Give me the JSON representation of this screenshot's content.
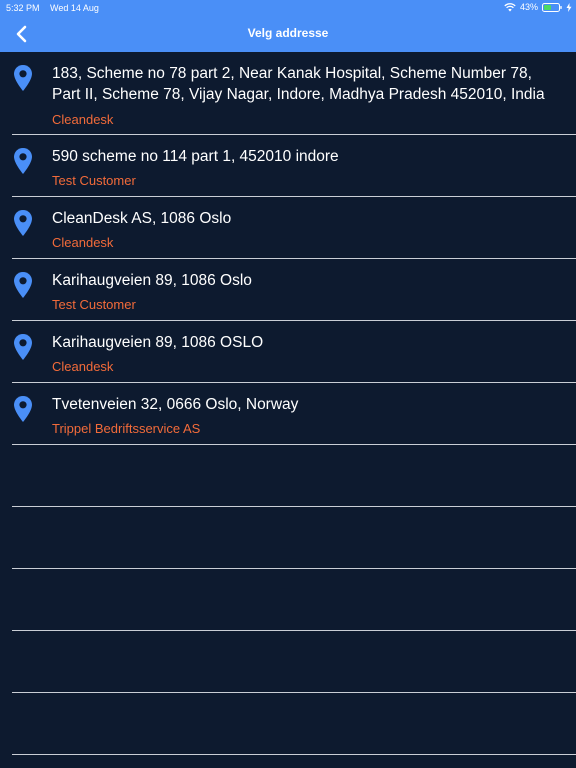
{
  "status": {
    "time": "5:32 PM",
    "date": "Wed 14 Aug",
    "battery": "43%"
  },
  "nav": {
    "title": "Velg addresse",
    "back_icon": "chevron-left-icon"
  },
  "colors": {
    "header": "#4a8ff7",
    "background": "#0d1a2f",
    "customer_text": "#f26b3a",
    "pin": "#4a8ff7"
  },
  "addresses": [
    {
      "address": "183, Scheme no 78 part 2, Near Kanak Hospital, Scheme Number 78, Part II, Scheme 78, Vijay Nagar, Indore, Madhya Pradesh 452010, India",
      "customer": "Cleandesk"
    },
    {
      "address": "590 scheme no 114 part 1, 452010 indore",
      "customer": "Test Customer"
    },
    {
      "address": "CleanDesk AS, 1086 Oslo",
      "customer": "Cleandesk"
    },
    {
      "address": "Karihaugveien 89, 1086 Oslo",
      "customer": "Test Customer"
    },
    {
      "address": "Karihaugveien 89, 1086 OSLO",
      "customer": "Cleandesk"
    },
    {
      "address": "Tvetenveien 32, 0666 Oslo, Norway",
      "customer": "Trippel Bedriftsservice AS"
    }
  ]
}
